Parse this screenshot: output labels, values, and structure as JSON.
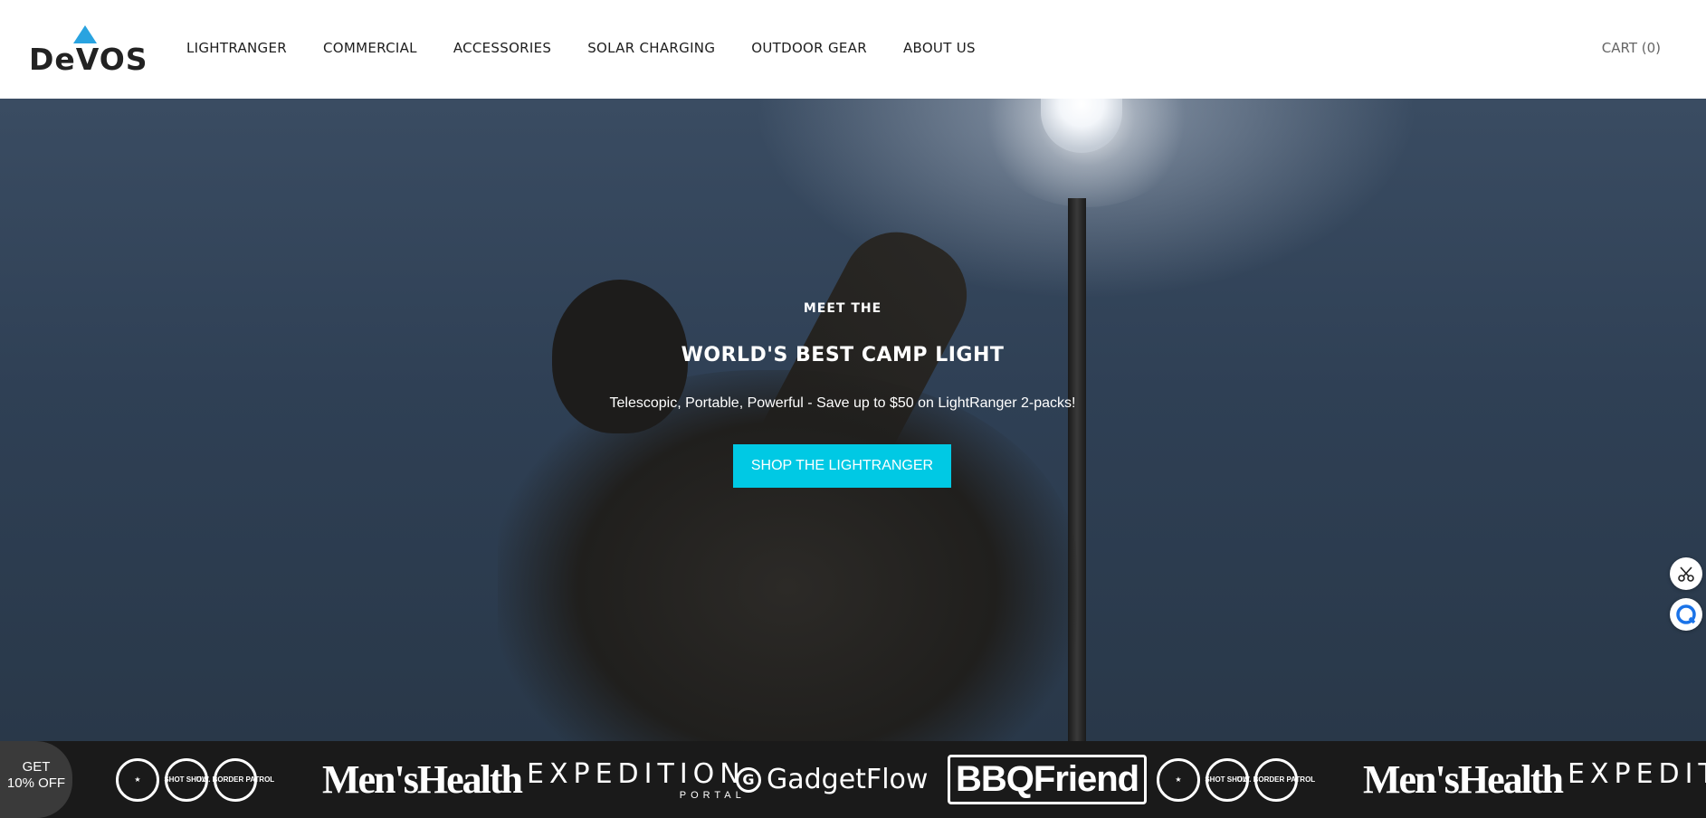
{
  "brand": {
    "name": "DeVOS",
    "accent": "#29a3e0"
  },
  "nav": {
    "items": [
      "LIGHTRANGER",
      "COMMERCIAL",
      "ACCESSORIES",
      "SOLAR CHARGING",
      "OUTDOOR GEAR",
      "ABOUT US"
    ],
    "cart_label": "CART (0)"
  },
  "hero": {
    "eyebrow": "MEET THE",
    "title": "WORLD'S BEST CAMP LIGHT",
    "subtitle": "Telescopic, Portable, Powerful - Save up to $50 on LightRanger 2-packs!",
    "cta_label": "SHOP THE LIGHTRANGER",
    "cta_color": "#00c9e4"
  },
  "press": {
    "logos": [
      "Men'sHealth",
      "EXPEDITION",
      "PORTAL",
      "GadgetFlow",
      "BBQFriend",
      "SHOT SHOW",
      "U.S. BORDER PATROL"
    ]
  },
  "discount_tab": {
    "line1": "GET",
    "line2": "10% OFF"
  },
  "icons": {
    "side_top": "scissors-icon",
    "side_bottom": "chat-icon"
  }
}
